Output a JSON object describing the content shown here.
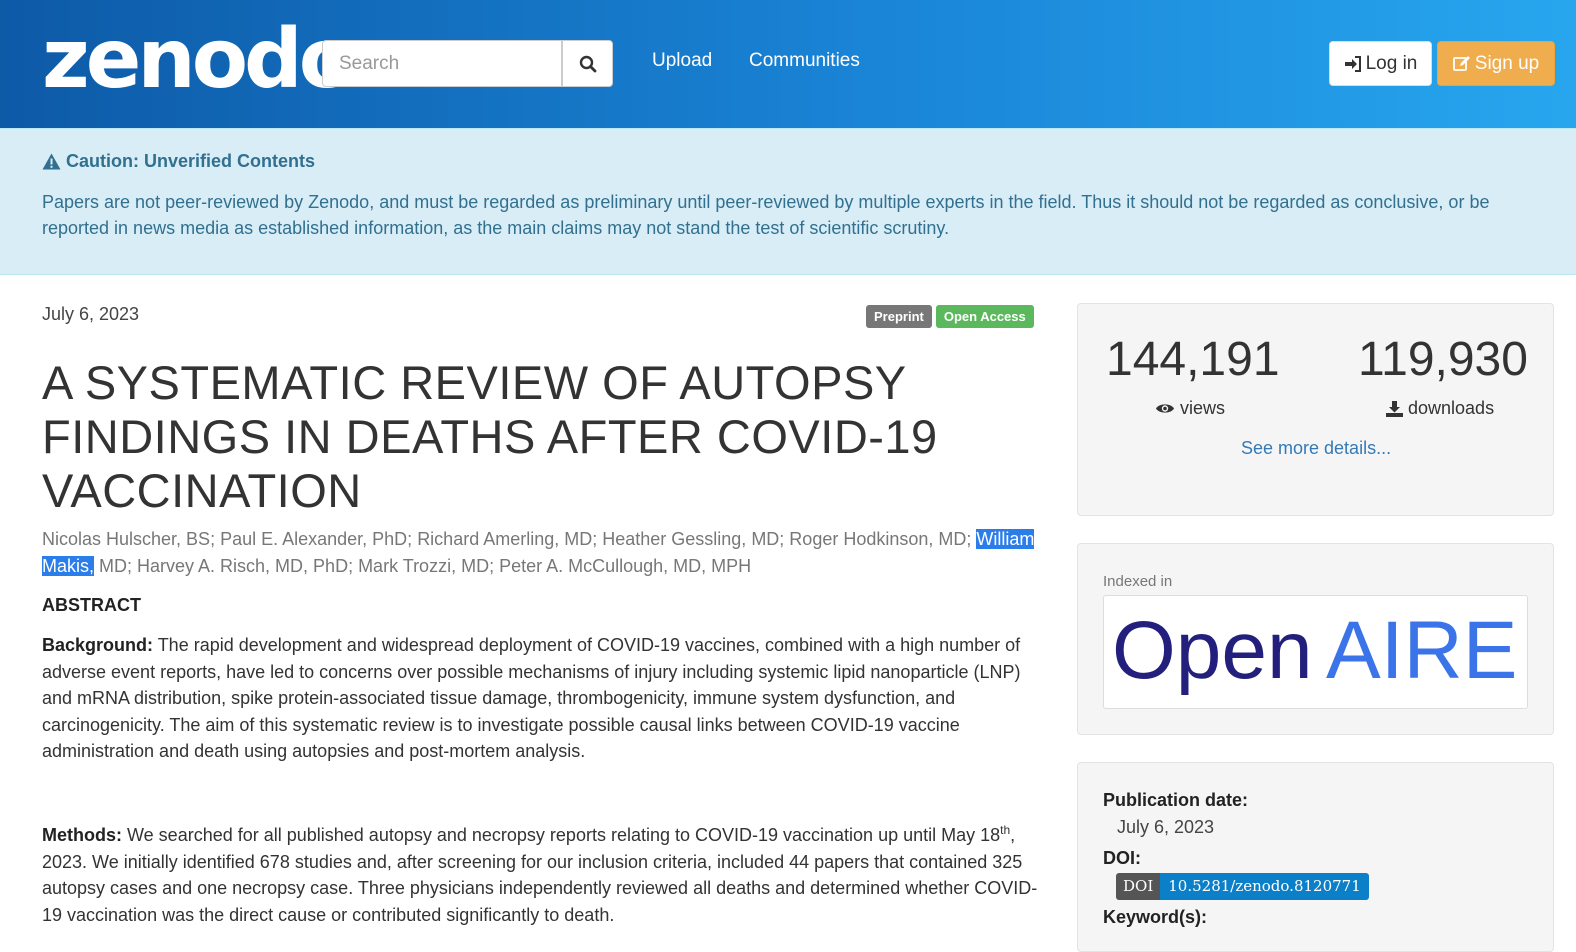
{
  "header": {
    "logo": "zenodo",
    "search_placeholder": "Search",
    "nav": [
      "Upload",
      "Communities"
    ],
    "login_label": "Log in",
    "signup_label": "Sign up"
  },
  "caution": {
    "title": "Caution: Unverified Contents",
    "text": "Papers are not peer-reviewed by Zenodo, and must be regarded as preliminary until peer-reviewed by multiple experts in the field. Thus it should not be regarded as conclusive, or be reported in news media as established information, as the main claims may not stand the test of scientific scrutiny."
  },
  "record": {
    "date": "July 6, 2023",
    "labels": [
      "Preprint",
      "Open Access"
    ],
    "title": "A SYSTEMATIC REVIEW OF AUTOPSY FINDINGS IN DEATHS AFTER COVID-19 VACCINATION",
    "authors_before": "Nicolas Hulscher, BS; Paul E. Alexander, PhD; Richard Amerling, MD; Heather Gessling, MD; Roger Hodkinson, MD; ",
    "authors_highlight": "William Makis,",
    "authors_after": " MD; Harvey A. Risch, MD, PhD; Mark Trozzi, MD; Peter A. McCullough, MD, MPH",
    "abstract_heading": "ABSTRACT",
    "background_label": "Background:",
    "background_text": " The rapid development and widespread deployment of COVID-19 vaccines, combined with a high number of adverse event reports, have led to concerns over possible mechanisms of injury including systemic lipid nanoparticle (LNP) and mRNA distribution, spike protein-associated tissue damage, thrombogenicity, immune system dysfunction, and carcinogenicity. The aim of this systematic review is to investigate possible causal links between COVID-19 vaccine administration and death using autopsies and post-mortem analysis.",
    "methods_label": "Methods:",
    "methods_text_1": " We searched for all published autopsy and necropsy reports relating to COVID-19 vaccination up until May 18",
    "methods_sup": "th",
    "methods_text_2": ", 2023. We initially identified 678 studies and, after screening for our inclusion criteria, included 44 papers that contained 325 autopsy cases and one necropsy case. Three physicians independently reviewed all deaths and determined whether COVID-19 vaccination was the direct cause or contributed significantly to death."
  },
  "stats": {
    "views": "144,191",
    "views_label": "views",
    "downloads": "119,930",
    "downloads_label": "downloads",
    "see_more": "See more details..."
  },
  "indexed": {
    "label": "Indexed in",
    "logo_open": "Open",
    "logo_aire": "AIRE"
  },
  "meta": {
    "pubdate_label": "Publication date:",
    "pubdate_value": "July 6, 2023",
    "doi_label": "DOI:",
    "doi_badge_left": "DOI",
    "doi_badge_right": "10.5281/zenodo.8120771",
    "keywords_label": "Keyword(s):"
  },
  "colors": {
    "header_start": "#0d5aa7",
    "header_end": "#27a6ee",
    "caution_bg": "#d9edf7",
    "caution_text": "#31708f",
    "preprint": "#777777",
    "open_access": "#5cb85c",
    "signup": "#f0ad4e",
    "link": "#337ab7",
    "openaire_navy": "#231f7c",
    "openaire_blue": "#3b74e8"
  }
}
